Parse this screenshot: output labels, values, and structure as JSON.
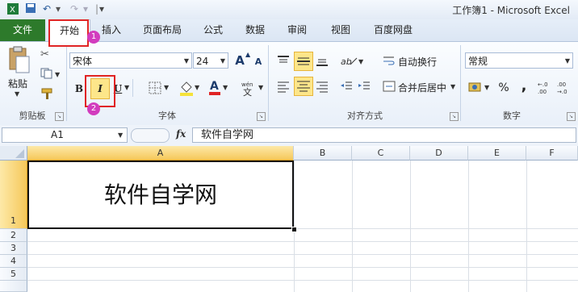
{
  "window": {
    "title": "工作簿1 - Microsoft Excel"
  },
  "quick_access": {
    "undo": "↶",
    "redo": "↷",
    "menu": "▾"
  },
  "tabs": [
    {
      "label": "文件"
    },
    {
      "label": "开始"
    },
    {
      "label": "插入"
    },
    {
      "label": "页面布局"
    },
    {
      "label": "公式"
    },
    {
      "label": "数据"
    },
    {
      "label": "审阅"
    },
    {
      "label": "视图"
    },
    {
      "label": "百度网盘"
    }
  ],
  "ribbon": {
    "clipboard": {
      "paste_label": "粘贴",
      "group_label": "剪贴板"
    },
    "font": {
      "font_name": "宋体",
      "font_size": "24",
      "bold": "B",
      "italic": "I",
      "underline": "U",
      "grow": "A",
      "shrink": "A",
      "group_label": "字体"
    },
    "alignment": {
      "wrap_text": "自动换行",
      "merge_center": "合并后居中",
      "group_label": "对齐方式"
    },
    "number": {
      "format": "常规",
      "percent": "%",
      "comma": ",",
      "group_label": "数字"
    }
  },
  "annotations": {
    "step1": "1",
    "step2": "2"
  },
  "formula_bar": {
    "name_box": "A1",
    "fx": "fx",
    "content": "软件自学网"
  },
  "sheet": {
    "columns": [
      "A",
      "B",
      "C",
      "D",
      "E",
      "F"
    ],
    "rows": [
      "1",
      "2",
      "3",
      "4",
      "5"
    ],
    "cell_a1": "软件自学网"
  },
  "colors": {
    "file_tab": "#2d7a2b",
    "highlight": "#e02424",
    "badge": "#d23cbe",
    "active_button": "#fde68a"
  }
}
